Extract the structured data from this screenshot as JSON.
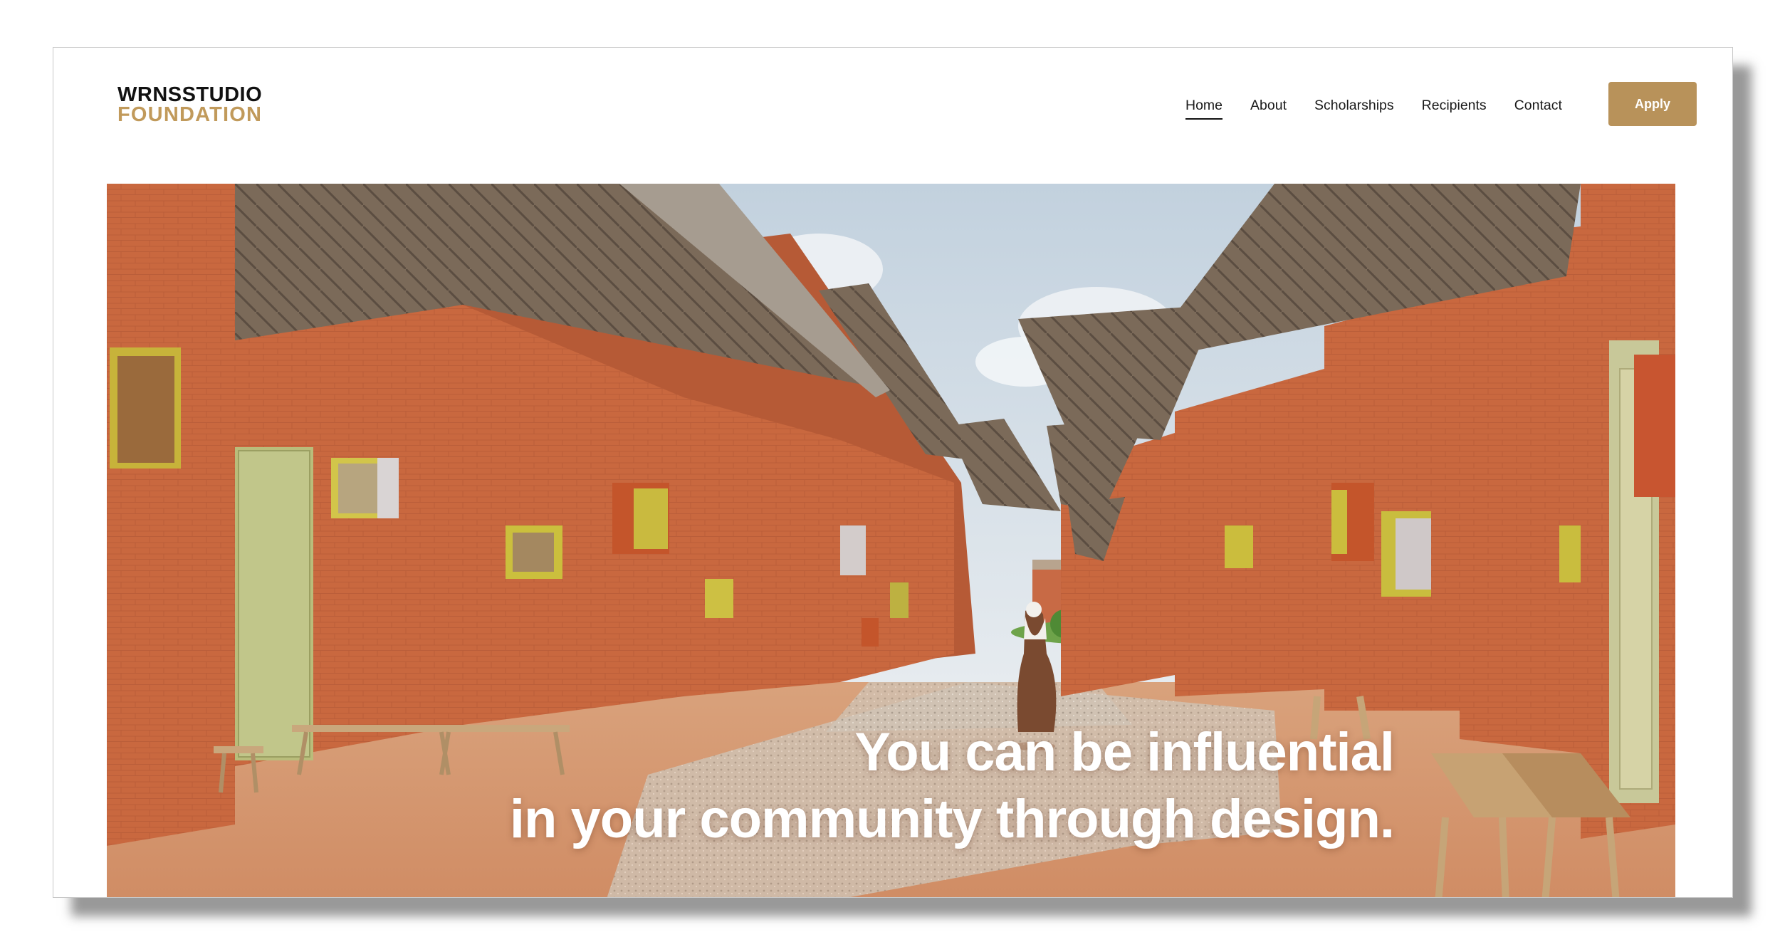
{
  "brand": {
    "line1": "WRNSSTUDIO",
    "line2": "FOUNDATION"
  },
  "nav": {
    "items": [
      {
        "label": "Home",
        "active": true
      },
      {
        "label": "About",
        "active": false
      },
      {
        "label": "Scholarships",
        "active": false
      },
      {
        "label": "Recipients",
        "active": false
      },
      {
        "label": "Contact",
        "active": false
      }
    ],
    "apply_label": "Apply"
  },
  "hero": {
    "line1": "You can be influential",
    "line2": "in your community through design.",
    "image_semantic": "photo-brick-school-courtyard"
  },
  "colors": {
    "brand_gold": "#c19a5b",
    "button_gold": "#b8925a",
    "brick": "#c8683f",
    "sky": "#cdd9e4",
    "ground": "#d89a74"
  }
}
